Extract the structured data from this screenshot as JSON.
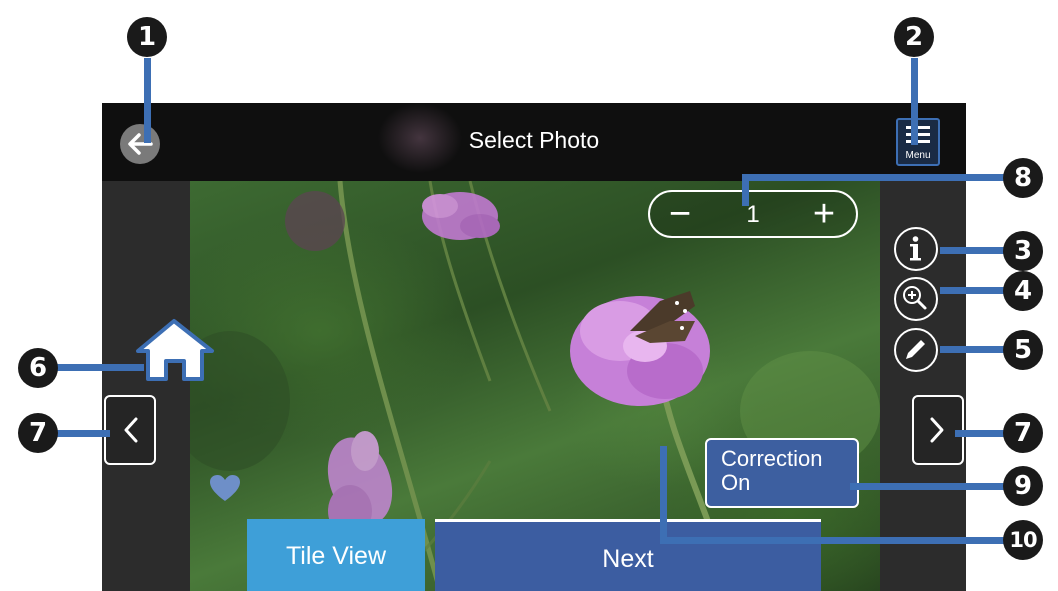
{
  "screen": {
    "title": "Select Photo",
    "menu_label": "Menu",
    "copies_value": "1",
    "stepper_minus": "−",
    "stepper_plus": "+",
    "correction_line1": "Correction",
    "correction_line2": "On",
    "tile_view_label": "Tile View",
    "next_label": "Next"
  },
  "icons": [
    "back-arrow-icon",
    "menu-icon",
    "info-icon",
    "zoom-in-icon",
    "edit-pencil-icon",
    "home-icon",
    "chevron-left-icon",
    "chevron-right-icon",
    "heart-icon"
  ],
  "callouts": {
    "back": "1",
    "menu": "2",
    "info": "3",
    "zoom": "4",
    "edit": "5",
    "home": "6",
    "prev": "7",
    "next_photo": "7",
    "copies": "8",
    "correction": "9",
    "photo_area": "10"
  },
  "colors": {
    "callout_line": "#3d6fb4",
    "tile_view": "#3e9fd8",
    "next": "#3c5da1",
    "correction": "#3d5fa0",
    "heart": "#6e8fc8"
  }
}
